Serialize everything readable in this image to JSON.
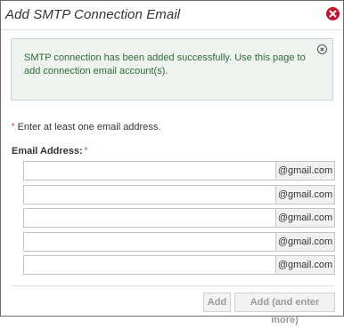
{
  "dialog": {
    "title": "Add SMTP Connection Email",
    "close_icon": "close-icon"
  },
  "alert": {
    "message": "SMTP connection has been added successfully. Use this page to add connection email account(s).",
    "close_icon": "dismiss-icon"
  },
  "form": {
    "required_star": "*",
    "required_note": " Enter at least one email address.",
    "email_label": "Email Address:",
    "email_rows": [
      {
        "value": "",
        "suffix": "@gmail.com"
      },
      {
        "value": "",
        "suffix": "@gmail.com"
      },
      {
        "value": "",
        "suffix": "@gmail.com"
      },
      {
        "value": "",
        "suffix": "@gmail.com"
      },
      {
        "value": "",
        "suffix": "@gmail.com"
      }
    ]
  },
  "buttons": {
    "add": "Add",
    "add_more": "Add (and enter more)"
  },
  "colors": {
    "close_red": "#c8102e",
    "alert_text_green": "#2f6b35",
    "alert_bg": "#eef3ef"
  }
}
